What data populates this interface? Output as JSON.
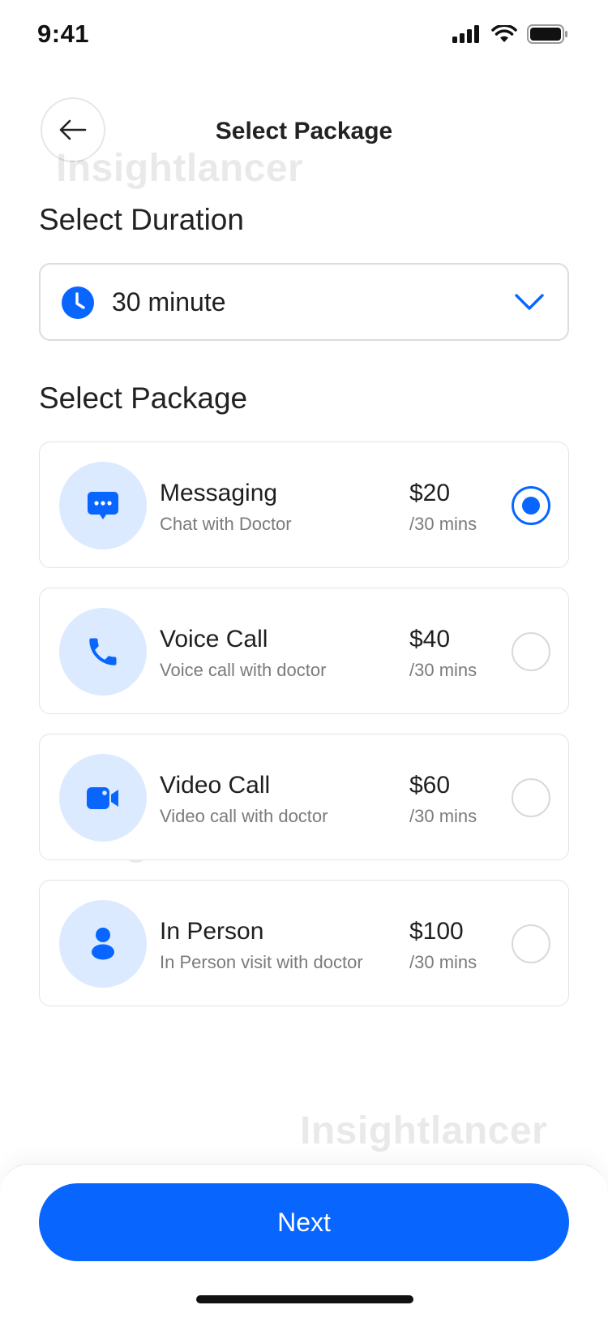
{
  "status_bar": {
    "time": "9:41"
  },
  "header": {
    "title": "Select Package"
  },
  "watermark": "Insightlancer",
  "duration": {
    "section_title": "Select Duration",
    "selected": "30 minute"
  },
  "packages": {
    "section_title": "Select Package",
    "items": [
      {
        "name": "Messaging",
        "description": "Chat with Doctor",
        "price": "$20",
        "unit": "/30 mins",
        "icon": "chat-icon",
        "selected": true
      },
      {
        "name": "Voice Call",
        "description": "Voice call with doctor",
        "price": "$40",
        "unit": "/30 mins",
        "icon": "phone-icon",
        "selected": false
      },
      {
        "name": "Video Call",
        "description": "Video call with doctor",
        "price": "$60",
        "unit": "/30 mins",
        "icon": "video-camera-icon",
        "selected": false
      },
      {
        "name": "In Person",
        "description": "In Person visit with doctor",
        "price": "$100",
        "unit": "/30 mins",
        "icon": "person-icon",
        "selected": false
      }
    ]
  },
  "footer": {
    "next_label": "Next"
  },
  "colors": {
    "accent": "#0866ff",
    "avatar_bg": "#dceaff"
  }
}
